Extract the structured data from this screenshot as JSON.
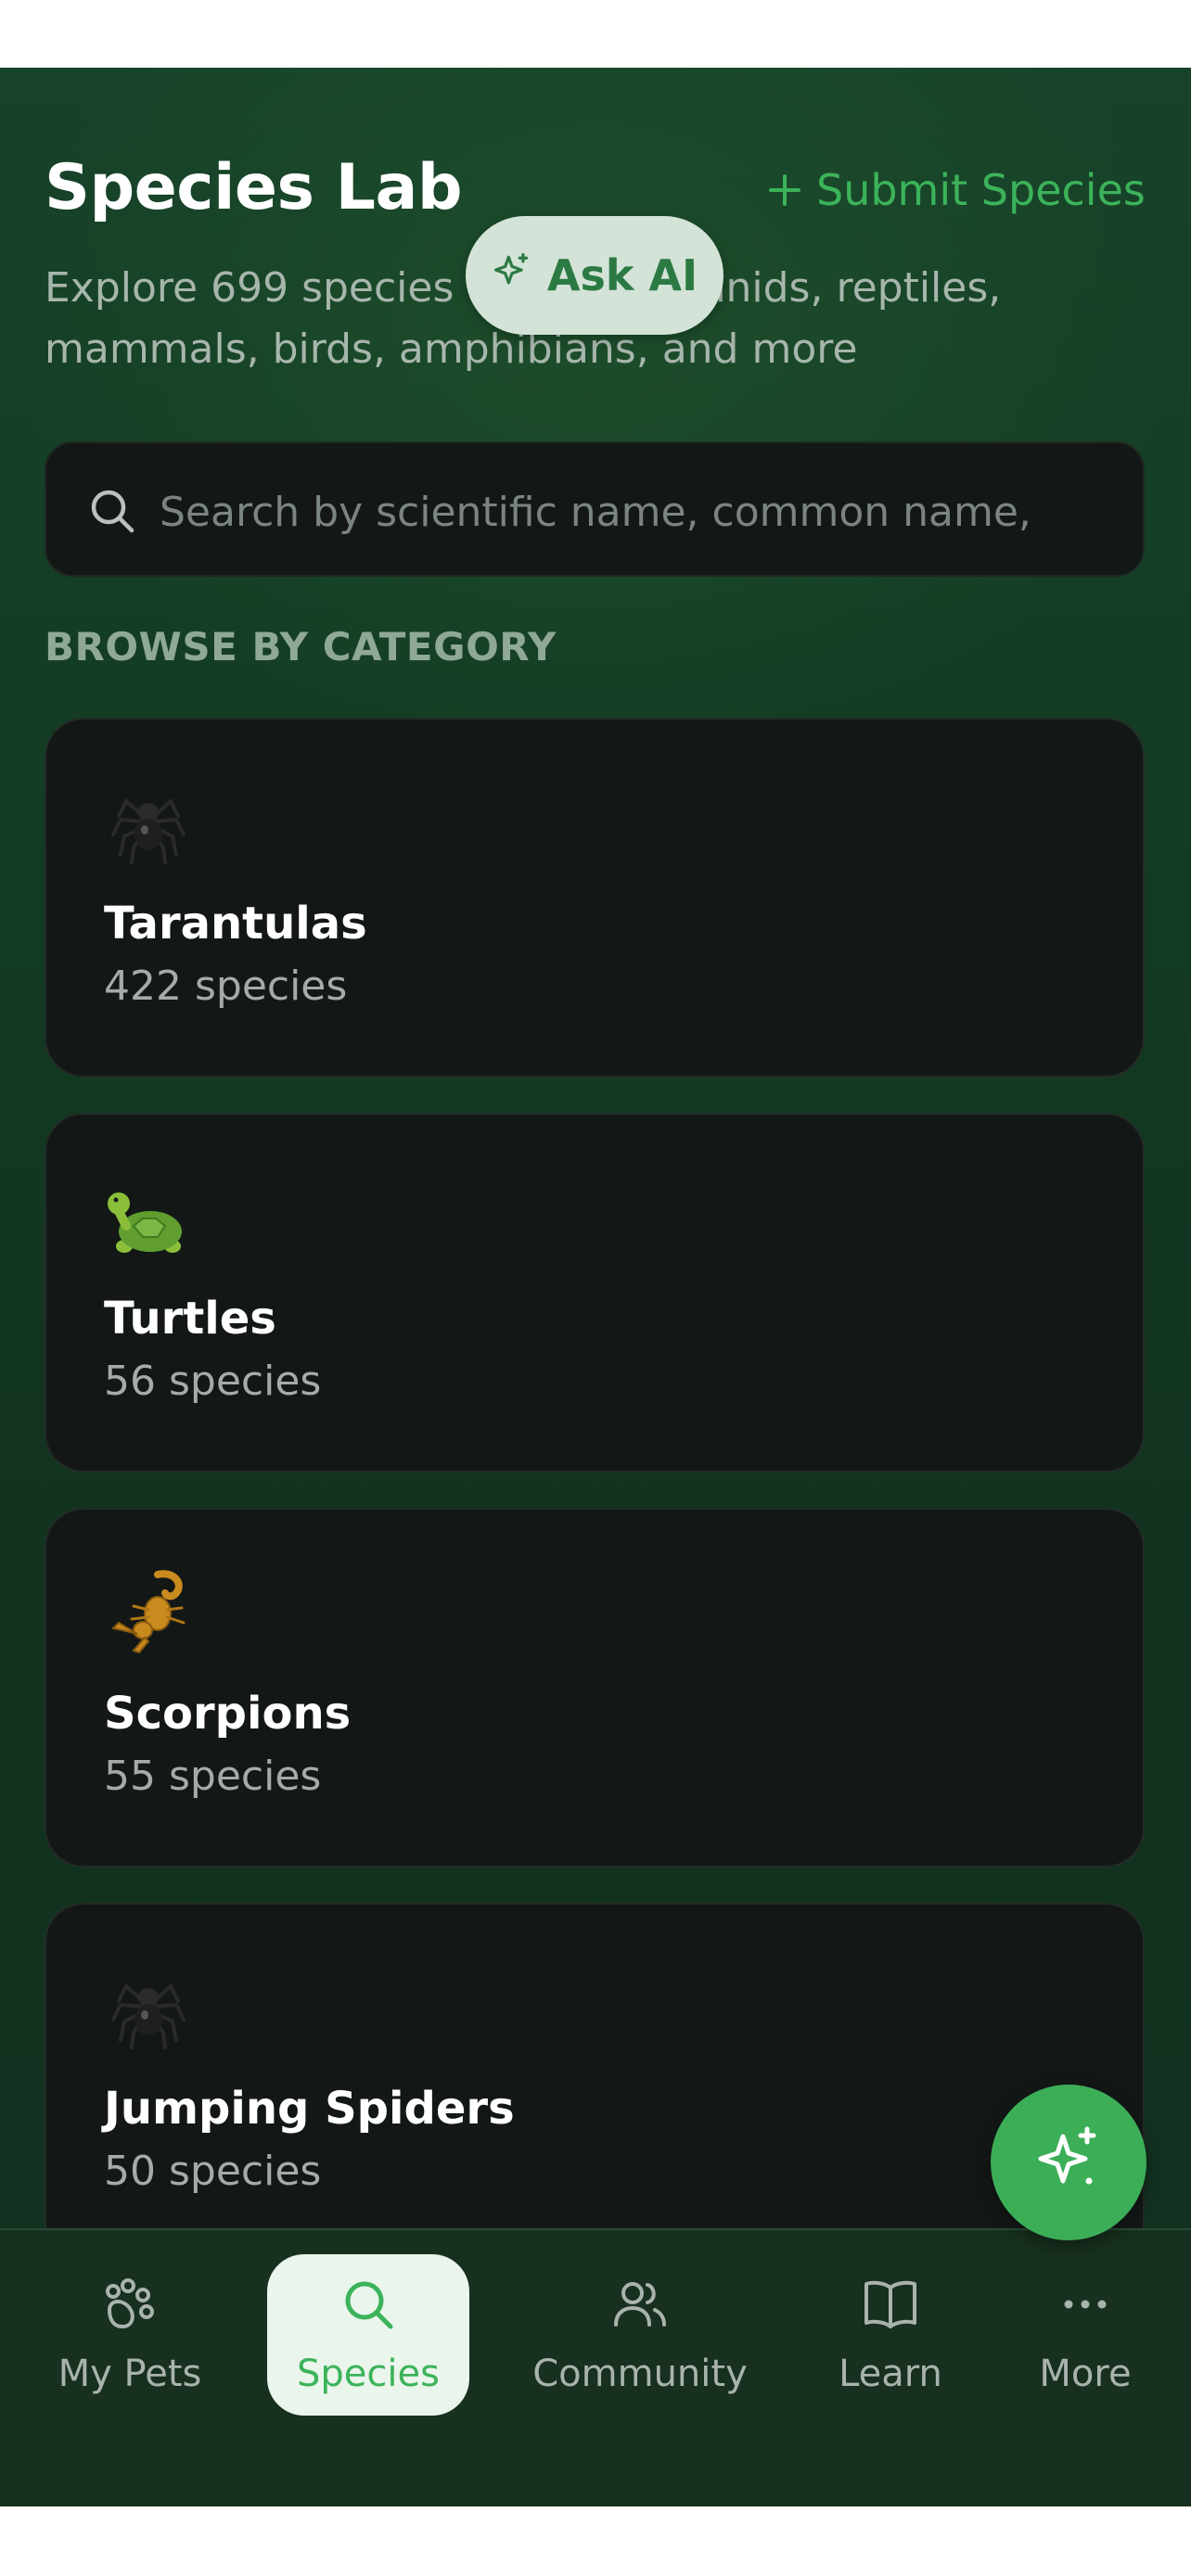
{
  "header": {
    "title": "Species Lab",
    "submit_label": "Submit Species",
    "subtitle": "Explore 699 species across arachnids, reptiles, mammals, birds, amphibians, and more"
  },
  "ask_ai": {
    "label": "Ask AI"
  },
  "search": {
    "placeholder": "Search by scientific name, common name,"
  },
  "section_label": "BROWSE BY CATEGORY",
  "categories": [
    {
      "name": "Tarantulas",
      "count": "422 species",
      "icon": "tarantula-icon"
    },
    {
      "name": "Turtles",
      "count": "56 species",
      "icon": "turtle-icon"
    },
    {
      "name": "Scorpions",
      "count": "55 species",
      "icon": "scorpion-icon"
    },
    {
      "name": "Jumping Spiders",
      "count": "50 species",
      "icon": "spider-icon"
    }
  ],
  "nav": {
    "items": [
      {
        "label": "My Pets",
        "icon": "paw-icon"
      },
      {
        "label": "Species",
        "icon": "search-icon",
        "active": true
      },
      {
        "label": "Community",
        "icon": "users-icon"
      },
      {
        "label": "Learn",
        "icon": "book-icon"
      },
      {
        "label": "More",
        "icon": "more-icon"
      }
    ]
  },
  "colors": {
    "accent": "#3cb35a",
    "background": "#133a23",
    "card": "#131816",
    "ask_ai_bg": "#d3e3d7"
  }
}
